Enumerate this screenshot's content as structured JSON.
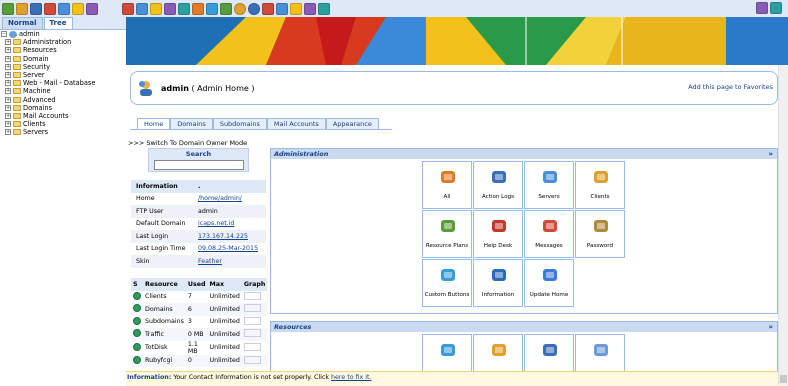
{
  "toolbar": {
    "left_icons": [
      "home-icon",
      "sync-icon",
      "mail-icon",
      "users-icon",
      "user-icon",
      "admin-icon",
      "help-icon"
    ],
    "mid_icons": [
      "star-icon",
      "globe-icon",
      "edit-icon",
      "user-icon",
      "list-icon",
      "list-icon",
      "list-icon",
      "refresh-icon",
      "circle-icon",
      "circle-icon",
      "save-icon",
      "users-icon",
      "users-icon",
      "users-icon",
      "chart-icon"
    ],
    "right_icons": [
      "binoculars-icon",
      "exit-icon"
    ]
  },
  "sidebar": {
    "tabs": [
      {
        "label": "Normal"
      },
      {
        "label": "Tree"
      }
    ],
    "root": "admin",
    "items": [
      {
        "label": "Administration"
      },
      {
        "label": "Resources"
      },
      {
        "label": "Domain"
      },
      {
        "label": "Security"
      },
      {
        "label": "Server"
      },
      {
        "label": "Web - Mail - Database"
      },
      {
        "label": "Machine"
      },
      {
        "label": "Advanced"
      },
      {
        "label": "Domains"
      },
      {
        "label": "Mail Accounts"
      },
      {
        "label": "Clients"
      },
      {
        "label": "Servers"
      }
    ]
  },
  "header": {
    "username": "admin",
    "subtitle": "Admin Home",
    "favorites_link": "Add this page to Favorites"
  },
  "tabs": [
    {
      "label": "Home"
    },
    {
      "label": "Domains"
    },
    {
      "label": "Subdomains"
    },
    {
      "label": "Mail Accounts"
    },
    {
      "label": "Appearance"
    }
  ],
  "left": {
    "switch_mode": ">>> Switch To Domain Owner Mode",
    "search_label": "Search",
    "search_value": "",
    "info_header": "Information",
    "info_header_value": ".",
    "info": [
      {
        "label": "Home",
        "value": "/home/admin/",
        "link": true
      },
      {
        "label": "FTP User",
        "value": "admin",
        "link": false
      },
      {
        "label": "Default Domain",
        "value": "icaps.net.id",
        "link": true
      },
      {
        "label": "Last Login",
        "value": "173.167.14.225",
        "link": true
      },
      {
        "label": "Last Login Time",
        "value": "09.08.25-Mar-2015",
        "link": true
      },
      {
        "label": "Skin",
        "value": "Feather",
        "link": true
      }
    ],
    "resources_headers": [
      "S",
      "Resource",
      "Used",
      "Max",
      "Graph"
    ],
    "resources": [
      {
        "resource": "Clients",
        "used": "7",
        "max": "Unlimited"
      },
      {
        "resource": "Domains",
        "used": "6",
        "max": "Unlimited"
      },
      {
        "resource": "Subdomains",
        "used": "3",
        "max": "Unlimited"
      },
      {
        "resource": "Traffic",
        "used": "0 MB",
        "max": "Unlimited"
      },
      {
        "resource": "TotDisk",
        "used": "1.1 MB",
        "max": "Unlimited"
      },
      {
        "resource": "Rubyfcgi",
        "used": "0",
        "max": "Unlimited"
      }
    ]
  },
  "admin_panel": {
    "title": "Administration",
    "items": [
      {
        "label": "All",
        "icon": "all-icon",
        "color": "#e07b2a"
      },
      {
        "label": "Action Logs",
        "icon": "action-logs-icon",
        "color": "#3a6fb7"
      },
      {
        "label": "Servers",
        "icon": "servers-icon",
        "color": "#4a90d9"
      },
      {
        "label": "Clients",
        "icon": "clients-icon",
        "color": "#e0a030"
      },
      {
        "label": "Resource Plans",
        "icon": "resource-plans-icon",
        "color": "#5a9c3a"
      },
      {
        "label": "Help Desk",
        "icon": "help-desk-icon",
        "color": "#c03a2a"
      },
      {
        "label": "Messages",
        "icon": "messages-icon",
        "color": "#d04a3a"
      },
      {
        "label": "Password",
        "icon": "password-icon",
        "color": "#b08a3a"
      },
      {
        "label": "Custom Buttons",
        "icon": "custom-buttons-icon",
        "color": "#3a9bd9"
      },
      {
        "label": "Information",
        "icon": "information-icon",
        "color": "#2a6ab7"
      },
      {
        "label": "Update Home",
        "icon": "update-home-icon",
        "color": "#3a7ad9"
      }
    ]
  },
  "resources_panel": {
    "title": "Resources",
    "icons": [
      {
        "icon": "circle-icon",
        "color": "#3a9bd9"
      },
      {
        "icon": "users-icon",
        "color": "#e0a030"
      },
      {
        "icon": "document-icon",
        "color": "#3a6fb7"
      },
      {
        "icon": "monitor-icon",
        "color": "#6a9ad9"
      }
    ]
  },
  "status": {
    "label": "Information:",
    "text": " Your Contact Information is not set properly. Click ",
    "link": "here to fix it."
  }
}
